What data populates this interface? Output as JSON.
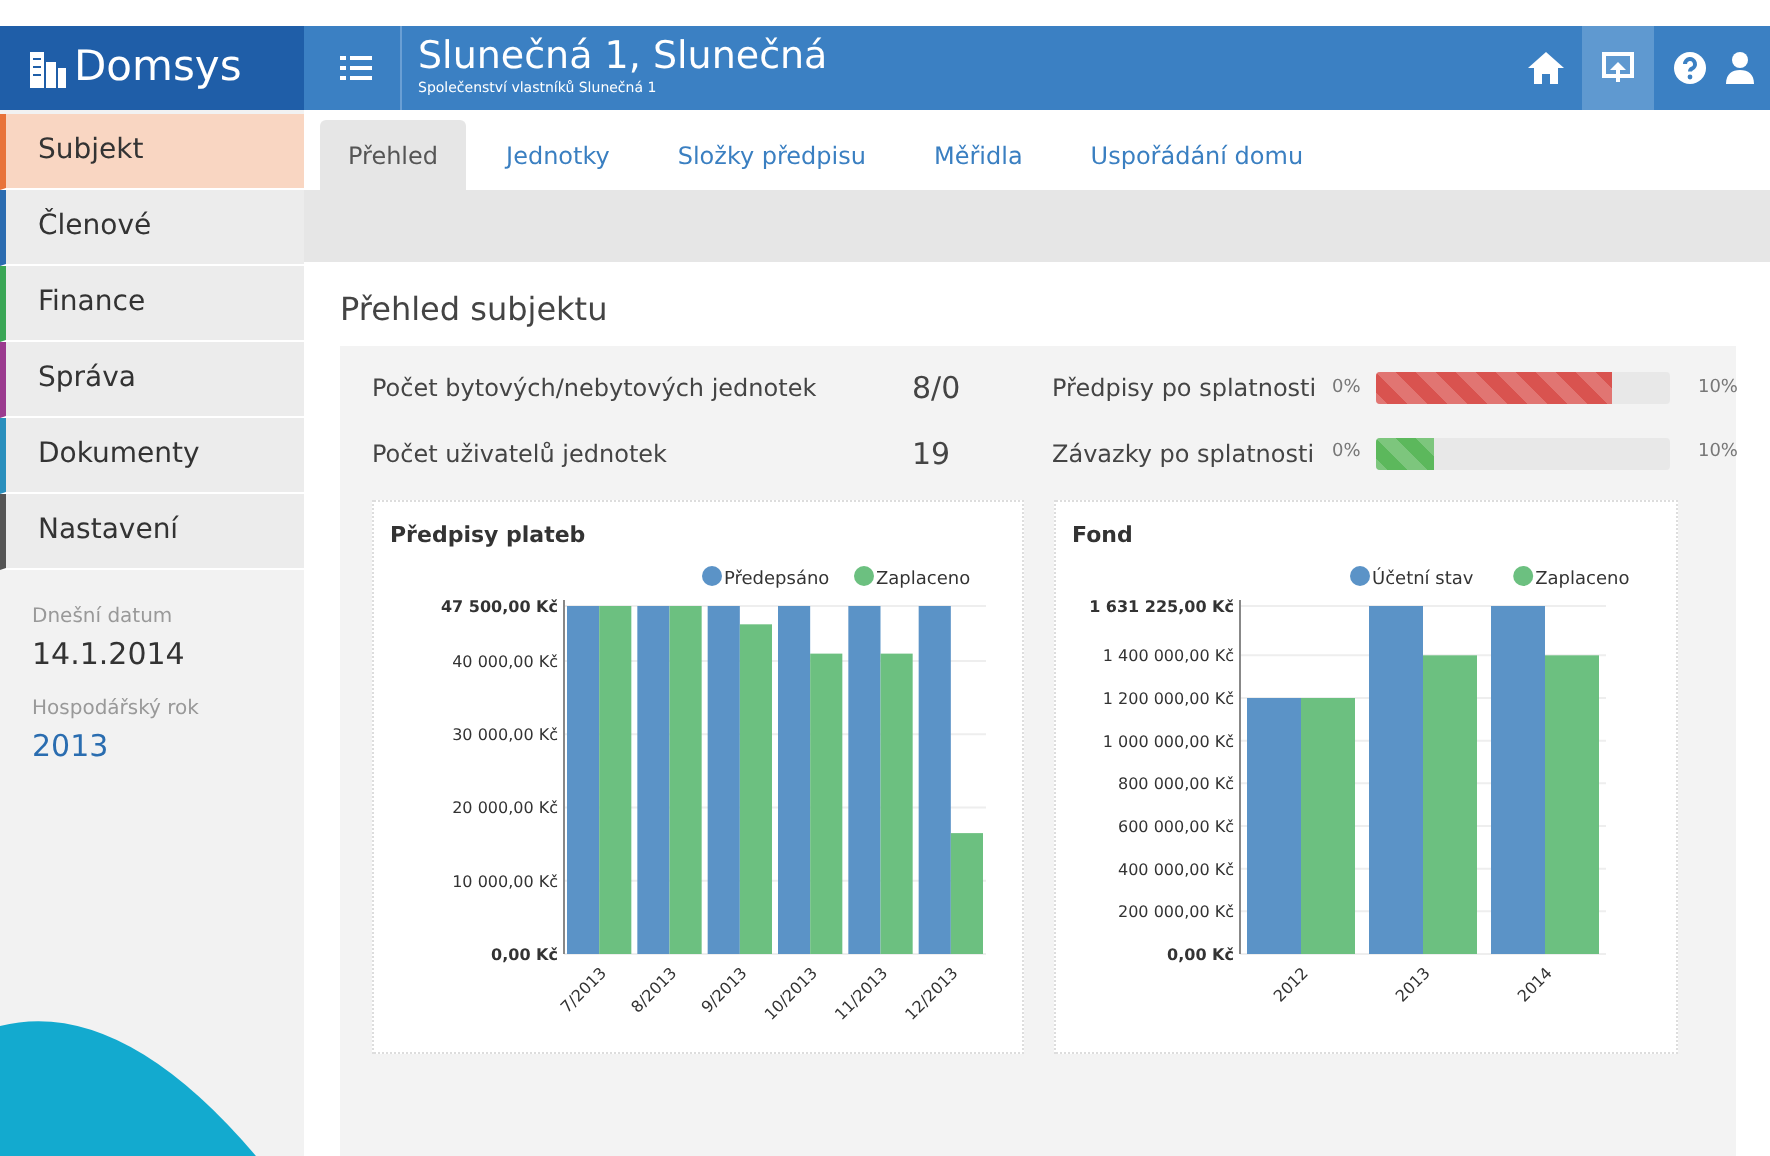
{
  "header": {
    "logo": "Domsys",
    "title": "Slunečná 1, Slunečná",
    "subtitle": "Společenství vlastníků Slunečná 1"
  },
  "sidebar": {
    "items": [
      {
        "label": "Subjekt",
        "selected": true,
        "color": "#e8733a"
      },
      {
        "label": "Členové",
        "selected": false,
        "color": "#2b6cb0"
      },
      {
        "label": "Finance",
        "selected": false,
        "color": "#3aa655"
      },
      {
        "label": "Správa",
        "selected": false,
        "color": "#9b3b8f"
      },
      {
        "label": "Dokumenty",
        "selected": false,
        "color": "#2a8fbd"
      },
      {
        "label": "Nastavení",
        "selected": false,
        "color": "#555555"
      }
    ],
    "info": [
      {
        "label": "Dnešní datum",
        "value": "14.1.2014",
        "kind": "plain"
      },
      {
        "label": "Hospodářský rok",
        "value": "2013",
        "kind": "link"
      }
    ]
  },
  "tabs": [
    {
      "label": "Přehled",
      "selected": true
    },
    {
      "label": "Jednotky",
      "selected": false
    },
    {
      "label": "Složky předpisu",
      "selected": false
    },
    {
      "label": "Měřidla",
      "selected": false
    },
    {
      "label": "Uspořádání domu",
      "selected": false
    }
  ],
  "overview": {
    "title": "Přehled subjektu",
    "stats": [
      {
        "label": "Počet bytových/nebytových jednotek",
        "value": "8/0"
      },
      {
        "label": "Počet uživatelů jednotek",
        "value": "19"
      }
    ],
    "progress": [
      {
        "label": "Předpisy po splatnosti",
        "min": "0%",
        "max": "10%",
        "level": 0.8,
        "color": "#d9534f",
        "striped": true
      },
      {
        "label": "Závazky po splatnosti",
        "min": "0%",
        "max": "10%",
        "level": 0.2,
        "color": "#5cb85c",
        "striped": true
      }
    ],
    "charts": [
      {
        "chart_data": {
          "type": "bar",
          "title": "Předpisy plateb",
          "categories": [
            "7/2013",
            "8/2013",
            "9/2013",
            "10/2013",
            "11/2013",
            "12/2013"
          ],
          "series": [
            {
              "name": "Předepsáno",
              "color": "#5b93c7",
              "values": [
                47500,
                47500,
                47500,
                47500,
                47500,
                47500
              ]
            },
            {
              "name": "Zaplaceno",
              "color": "#6cc080",
              "values": [
                47500,
                47500,
                45000,
                41000,
                41000,
                16500
              ]
            }
          ],
          "ylim": [
            0,
            47500
          ],
          "grid": true,
          "legend": true,
          "yticks": [
            {
              "value": 0,
              "label": "0,00 Kč"
            },
            {
              "value": 10000,
              "label": "10 000,00 Kč"
            },
            {
              "value": 20000,
              "label": "20 000,00 Kč"
            },
            {
              "value": 30000,
              "label": "30 000,00 Kč"
            },
            {
              "value": 40000,
              "label": "40 000,00 Kč"
            },
            {
              "value": 47500,
              "label": "47 500,00 Kč"
            }
          ]
        }
      },
      {
        "chart_data": {
          "type": "bar",
          "title": "Fond",
          "categories": [
            "2012",
            "2013",
            "2014"
          ],
          "series": [
            {
              "name": "Účetní stav",
              "color": "#5b93c7",
              "values": [
                1200000,
                1631225,
                1631225
              ]
            },
            {
              "name": "Zaplaceno",
              "color": "#6cc080",
              "values": [
                1200000,
                1400000,
                1400000
              ]
            }
          ],
          "ylim": [
            0,
            1631225
          ],
          "grid": true,
          "legend": true,
          "yticks": [
            {
              "value": 0,
              "label": "0,00 Kč"
            },
            {
              "value": 200000,
              "label": "200 000,00 Kč"
            },
            {
              "value": 400000,
              "label": "400 000,00 Kč"
            },
            {
              "value": 600000,
              "label": "600 000,00 Kč"
            },
            {
              "value": 800000,
              "label": "800 000,00 Kč"
            },
            {
              "value": 1000000,
              "label": "1 000 000,00 Kč"
            },
            {
              "value": 1200000,
              "label": "1 200 000,00 Kč"
            },
            {
              "value": 1400000,
              "label": "1 400 000,00 Kč"
            },
            {
              "value": 1631225,
              "label": "1 631 225,00 Kč"
            }
          ]
        }
      }
    ]
  }
}
